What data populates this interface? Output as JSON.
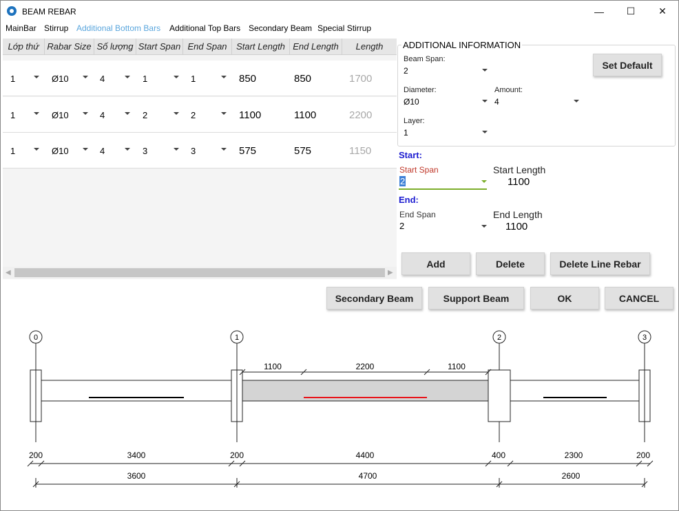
{
  "window": {
    "title": "BEAM REBAR",
    "minimize_glyph": "—",
    "maximize_glyph": "☐",
    "close_glyph": "✕"
  },
  "menu": [
    "MainBar",
    "Stirrup",
    "Additional Bottom Bars",
    "Additional Top Bars",
    "Secondary Beam",
    "Special Stirrup"
  ],
  "grid": {
    "columns": [
      "Lớp thứ",
      "Rabar Size",
      "Số lượng",
      "Start Span",
      "End Span",
      "Start Length",
      "End Length",
      "Length"
    ],
    "rows": [
      {
        "layer": "1",
        "size": "Ø10",
        "amount": "4",
        "start_span": "1",
        "end_span": "1",
        "start_length": "850",
        "end_length": "850",
        "length": "1700"
      },
      {
        "layer": "1",
        "size": "Ø10",
        "amount": "4",
        "start_span": "2",
        "end_span": "2",
        "start_length": "1100",
        "end_length": "1100",
        "length": "2200"
      },
      {
        "layer": "1",
        "size": "Ø10",
        "amount": "4",
        "start_span": "3",
        "end_span": "3",
        "start_length": "575",
        "end_length": "575",
        "length": "1150"
      }
    ],
    "scroll_left": "◀",
    "scroll_right": "▶"
  },
  "info": {
    "title": "ADDITIONAL INFORMATION",
    "beam_span_label": "Beam Span:",
    "beam_span_value": "2",
    "diameter_label": "Diameter:",
    "diameter_value": "Ø10",
    "amount_label": "Amount:",
    "amount_value": "4",
    "layer_label": "Layer:",
    "layer_value": "1",
    "set_default": "Set Default"
  },
  "start": {
    "heading": "Start:",
    "span_label": "Start Span",
    "span_value": "2",
    "length_label": "Start Length",
    "length_value": "1100"
  },
  "end": {
    "heading": "End:",
    "span_label": "End Span",
    "span_value": "2",
    "length_label": "End Length",
    "length_value": "1100"
  },
  "buttons": {
    "add": "Add",
    "delete": "Delete",
    "delete_line": "Delete Line Rebar",
    "secondary_beam": "Secondary Beam",
    "support_beam": "Support Beam",
    "ok": "OK",
    "cancel": "CANCEL"
  },
  "drawing": {
    "axes": [
      "0",
      "1",
      "2",
      "3"
    ],
    "top_dims": [
      "1100",
      "2200",
      "1100"
    ],
    "dims_row1": [
      "200",
      "3400",
      "200",
      "4400",
      "400",
      "2300",
      "200"
    ],
    "dims_row2": [
      "3600",
      "4700",
      "2600"
    ],
    "colors": {
      "highlight_rebar": "#e8141a",
      "rebar": "#000000",
      "beam_fill_selected": "#d4d4d4"
    }
  }
}
